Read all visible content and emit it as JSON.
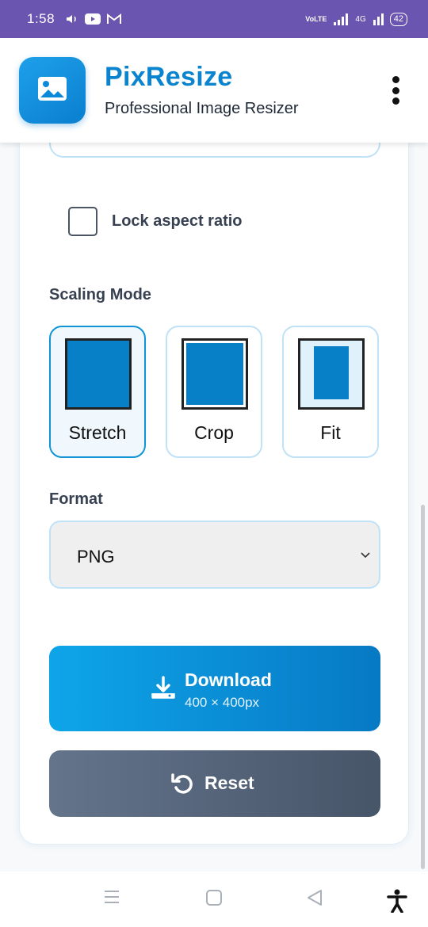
{
  "status_bar": {
    "time": "1:58",
    "network_label": "VoLTE",
    "network_type": "4G",
    "battery": "42",
    "icons": [
      "volume-icon",
      "youtube-icon",
      "gmail-icon",
      "volte-icon",
      "signal-icon",
      "signal-4g-icon",
      "battery-icon"
    ]
  },
  "header": {
    "title": "PixResize",
    "subtitle": "Professional Image Resizer",
    "logo_icon": "image-icon",
    "menu_icon": "more-vertical-icon"
  },
  "options": {
    "lock_aspect_label": "Lock aspect ratio",
    "lock_aspect_checked": false
  },
  "scaling": {
    "label": "Scaling Mode",
    "modes": [
      {
        "label": "Stretch",
        "selected": true
      },
      {
        "label": "Crop",
        "selected": false
      },
      {
        "label": "Fit",
        "selected": false
      }
    ]
  },
  "format": {
    "label": "Format",
    "value": "PNG"
  },
  "actions": {
    "download_label": "Download",
    "download_size": "400 × 400px",
    "reset_label": "Reset"
  },
  "colors": {
    "accent": "#0b84cf",
    "status_bar": "#6a55b0",
    "download_start": "#0ea5e9",
    "download_end": "#0779c4",
    "reset_start": "#64748b",
    "reset_end": "#475569"
  },
  "nav": {
    "icons": [
      "recent-apps-icon",
      "home-icon",
      "back-icon",
      "accessibility-icon"
    ]
  }
}
